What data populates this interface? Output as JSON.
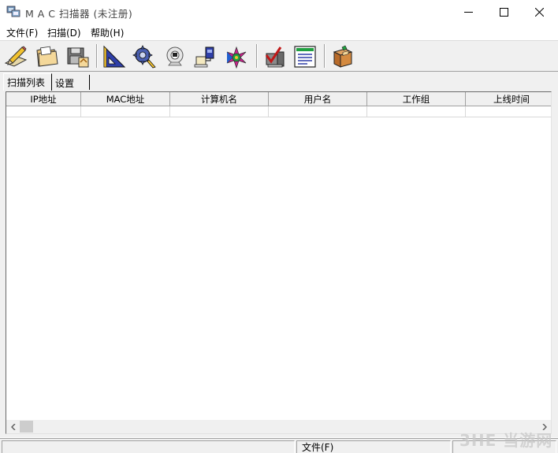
{
  "window": {
    "title": "M A C 扫描器   (未注册)",
    "controls": [
      "minimize",
      "maximize",
      "close"
    ]
  },
  "menu": {
    "items": [
      {
        "label": "文件(F)"
      },
      {
        "label": "扫描(D)"
      },
      {
        "label": "帮助(H)"
      }
    ]
  },
  "toolbar": {
    "buttons": [
      {
        "icon": "edit-pencil-icon"
      },
      {
        "icon": "open-folder-icon"
      },
      {
        "icon": "save-disk-icon"
      },
      {
        "icon": "ruler-triangle-icon"
      },
      {
        "icon": "settings-gear-icon"
      },
      {
        "icon": "webcam-icon"
      },
      {
        "icon": "network-computer-icon"
      },
      {
        "icon": "color-wheel-icon"
      },
      {
        "icon": "check-computer-icon"
      },
      {
        "icon": "report-list-icon"
      },
      {
        "icon": "cabinet-icon"
      }
    ]
  },
  "tabs": [
    {
      "label": "扫描列表",
      "active": true
    },
    {
      "label": "设置",
      "active": false
    }
  ],
  "table": {
    "columns": [
      "IP地址",
      "MAC地址",
      "计算机名",
      "用户名",
      "工作组",
      "上线时间"
    ],
    "rows": [
      [
        "",
        "",
        "",
        "",
        "",
        ""
      ]
    ]
  },
  "statusbar": {
    "panes": [
      "",
      "文件(F)",
      ""
    ]
  },
  "watermark": "3HE 当游网",
  "colors": {
    "chrome": "#f0f0f0",
    "window": "#ffffff",
    "border": "#a0a0a0"
  }
}
